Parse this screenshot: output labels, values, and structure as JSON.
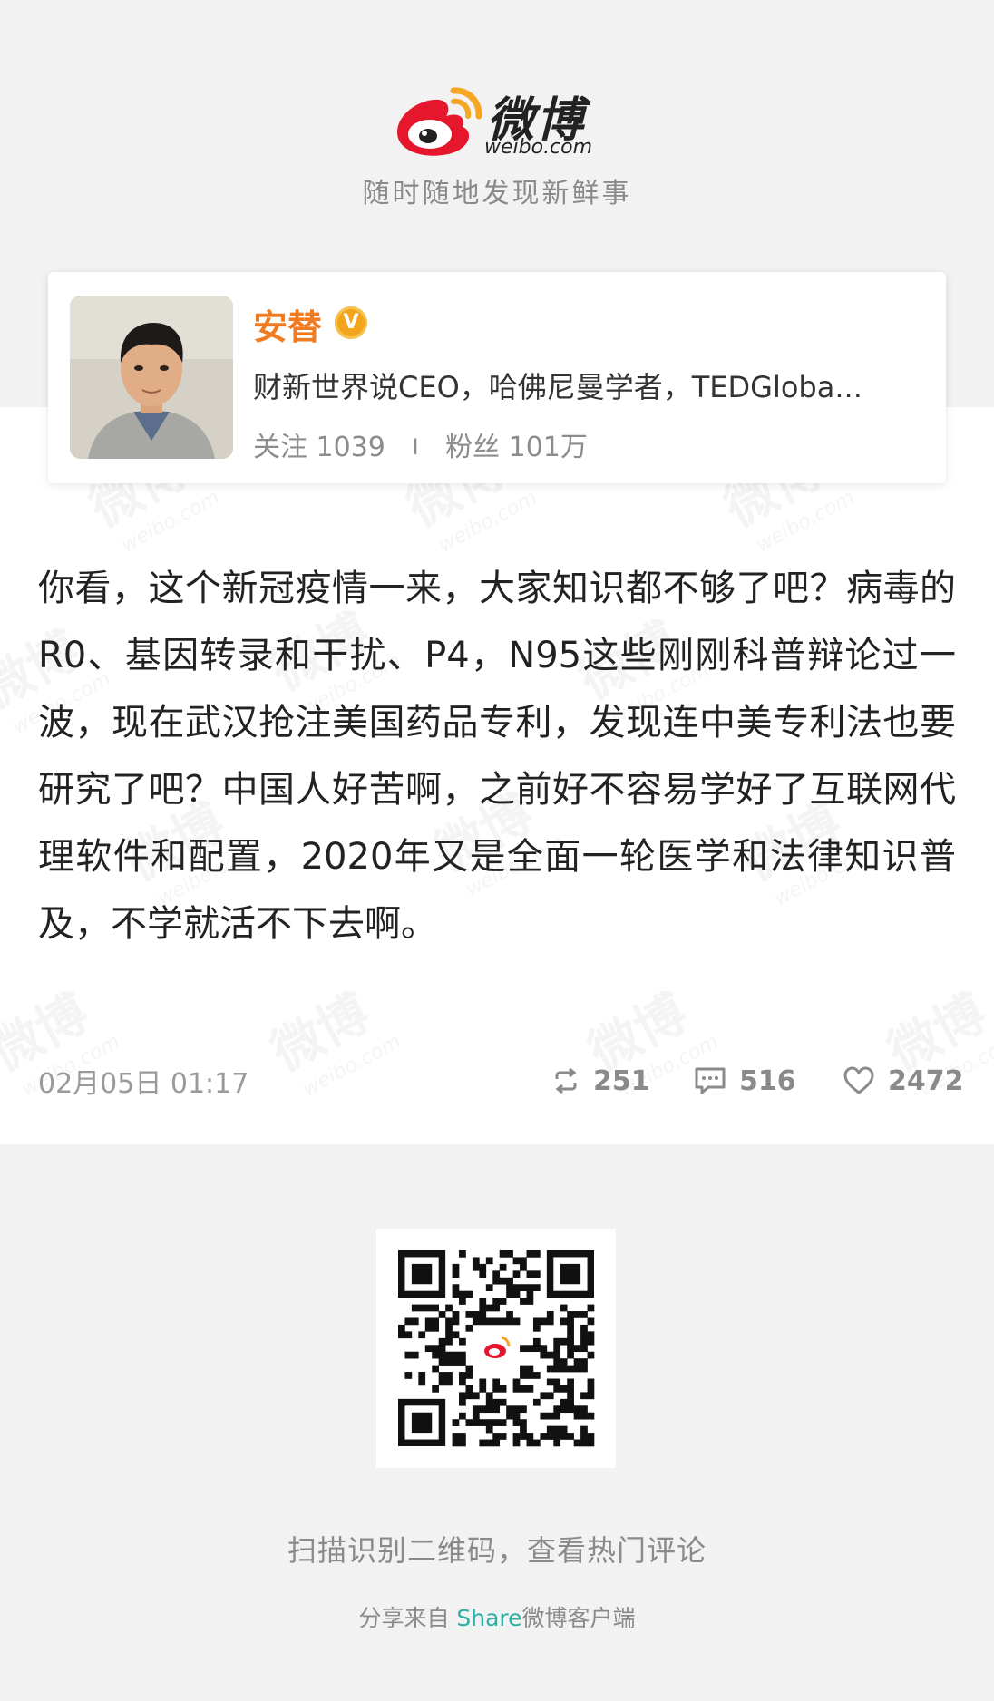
{
  "header": {
    "logo_text": "微博",
    "logo_sub": "weibo.com",
    "tagline": "随时随地发现新鲜事"
  },
  "profile": {
    "name": "安替",
    "verified_badge": "V",
    "bio": "财新世界说CEO，哈佛尼曼学者，TEDGloba...",
    "following_label": "关注",
    "following_count": "1039",
    "separator": "I",
    "followers_label": "粉丝",
    "followers_count": "101万"
  },
  "post": {
    "text": "你看，这个新冠疫情一来，大家知识都不够了吧？病毒的R0、基因转录和干扰、P4，N95这些刚刚科普辩论过一波，现在武汉抢注美国药品专利，发现连中美专利法也要研究了吧？中国人好苦啊，之前好不容易学好了互联网代理软件和配置，2020年又是全面一轮医学和法律知识普及，不学就活不下去啊。",
    "timestamp": "02月05日 01:17",
    "reposts": "251",
    "comments": "516",
    "likes": "2472",
    "watermark_text": "微博",
    "watermark_sub": "weibo.com"
  },
  "footer": {
    "scan_text": "扫描识别二维码，查看热门评论",
    "share_prefix": "分享来自 ",
    "share_accent": "Share",
    "share_suffix": "微博客户端"
  },
  "colors": {
    "brand_orange": "#f07b21",
    "weibo_red": "#e6162d",
    "share_accent": "#2bb1a7",
    "background": "#f2f2f2"
  },
  "icons": [
    "weibo-logo-icon",
    "verified-v-icon",
    "repost-icon",
    "comment-icon",
    "like-heart-icon",
    "qr-code-icon"
  ]
}
